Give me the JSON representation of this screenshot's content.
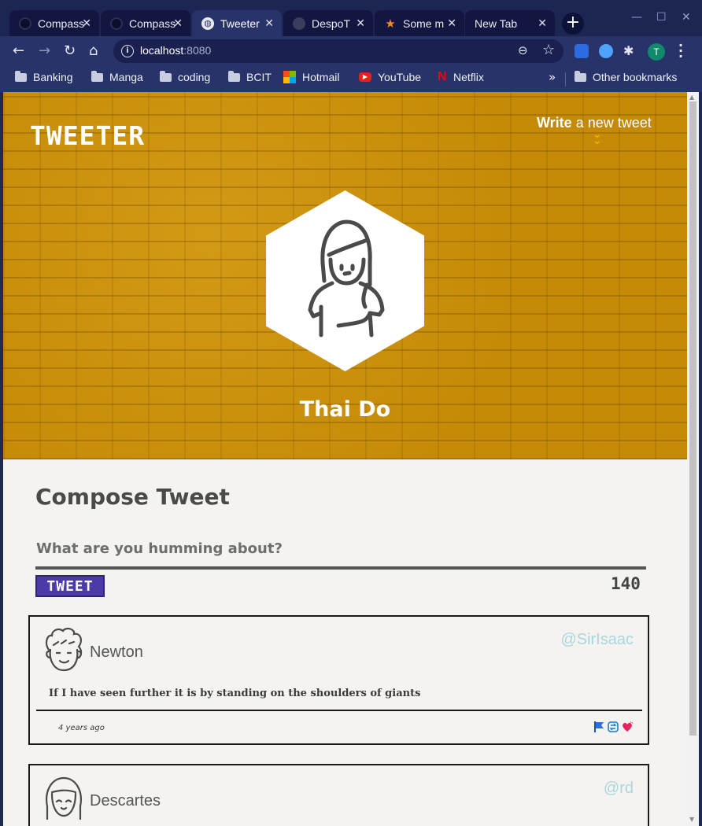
{
  "browser": {
    "tabs": [
      {
        "label": "Compass",
        "favicon": "github-icon"
      },
      {
        "label": "Compass",
        "favicon": "github-icon"
      },
      {
        "label": "Tweeter",
        "favicon": "globe-icon"
      },
      {
        "label": "DespoT",
        "favicon": "github-icon"
      },
      {
        "label": "Some m",
        "favicon": "star-icon"
      },
      {
        "label": "New Tab",
        "favicon": ""
      }
    ],
    "url_host": "localhost",
    "url_port": ":8080",
    "avatar_initial": "T",
    "bookmarks": [
      {
        "label": "Banking",
        "icon": "folder-icon"
      },
      {
        "label": "Manga",
        "icon": "folder-icon"
      },
      {
        "label": "coding",
        "icon": "folder-icon"
      },
      {
        "label": "BCIT",
        "icon": "folder-icon"
      },
      {
        "label": "Hotmail",
        "icon": "microsoft-icon"
      },
      {
        "label": "YouTube",
        "icon": "youtube-icon"
      },
      {
        "label": "Netflix",
        "icon": "netflix-icon"
      }
    ],
    "other_bookmarks": "Other bookmarks"
  },
  "header": {
    "logo": "TWEETER",
    "write_bold": "Write",
    "write_rest": " a new tweet",
    "username": "Thai Do"
  },
  "compose": {
    "title": "Compose Tweet",
    "placeholder": "What are you humming about?",
    "button": "TWEET",
    "counter": "140"
  },
  "tweets": [
    {
      "name": "Newton",
      "handle": "@SirIsaac",
      "text": "If I have seen further it is by standing on the shoulders of giants",
      "age": "4 years ago",
      "actions": [
        "flag-icon",
        "retweet-icon",
        "heart-icon"
      ]
    },
    {
      "name": "Descartes",
      "handle": "@rd"
    }
  ],
  "colors": {
    "hero": "#c48a08",
    "tweet_button": "#4b3aa8",
    "handle": "#a9d6e0",
    "chrome": "#28336a"
  }
}
